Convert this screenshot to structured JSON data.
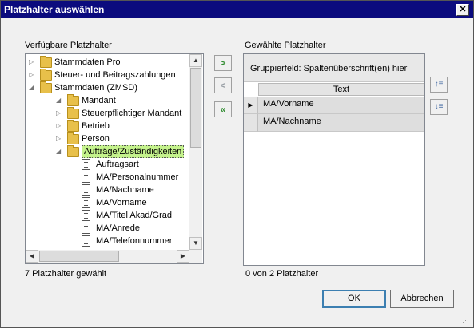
{
  "window": {
    "title": "Platzhalter auswählen",
    "close_glyph": "✕"
  },
  "left": {
    "label": "Verfügbare Platzhalter",
    "status": "7 Platzhalter gewählt",
    "tree": [
      {
        "label": "Stammdaten Pro",
        "icon": "folder-icon",
        "expander": "▷"
      },
      {
        "label": "Steuer- und Beitragszahlungen",
        "icon": "folder-icon",
        "expander": "▷"
      },
      {
        "label": "Stammdaten (ZMSD)",
        "icon": "folder-icon",
        "expander": "◢"
      },
      {
        "label": "Mandant",
        "icon": "folder-icon",
        "expander": "◢"
      },
      {
        "label": "Steuerpflichtiger Mandant",
        "icon": "folder-icon",
        "expander": "▷"
      },
      {
        "label": "Betrieb",
        "icon": "folder-icon",
        "expander": "▷"
      },
      {
        "label": "Person",
        "icon": "folder-icon",
        "expander": "▷"
      },
      {
        "label": "Aufträge/Zuständigkeiten",
        "icon": "folder-icon",
        "expander": "◢",
        "selected": true
      },
      {
        "label": "Auftragsart",
        "icon": "document-icon"
      },
      {
        "label": "MA/Personalnummer",
        "icon": "document-icon"
      },
      {
        "label": "MA/Nachname",
        "icon": "document-icon"
      },
      {
        "label": "MA/Vorname",
        "icon": "document-icon"
      },
      {
        "label": "MA/Titel Akad/Grad",
        "icon": "document-icon"
      },
      {
        "label": "MA/Anrede",
        "icon": "document-icon"
      },
      {
        "label": "MA/Telefonnummer",
        "icon": "document-icon"
      }
    ],
    "scroll_glyphs": {
      "up": "▲",
      "down": "▼",
      "left": "◀",
      "right": "▶"
    }
  },
  "middle_buttons": [
    {
      "glyph": ">",
      "color": "#2e8b2e"
    },
    {
      "glyph": "<",
      "color": "#9aa0a6"
    },
    {
      "glyph": "«",
      "color": "#2e8b2e"
    }
  ],
  "right": {
    "label": "Gewählte Platzhalter",
    "group_panel": "Gruppierfeld: Spaltenüberschrift(en) hier",
    "column_header": "Text",
    "rows": [
      {
        "text": "MA/Vorname",
        "current": true,
        "indicator": "▶"
      },
      {
        "text": "MA/Nachname",
        "current": false,
        "indicator": ""
      }
    ],
    "status": "0 von 2 Platzhalter",
    "move_up_glyph": "↑≡",
    "move_down_glyph": "↓≡"
  },
  "buttons": {
    "ok": "OK",
    "cancel": "Abbrechen"
  },
  "colors": {
    "titlebar": "#0b0b7e",
    "selection": "#c4f28c",
    "green_arrow": "#2e8b2e"
  }
}
